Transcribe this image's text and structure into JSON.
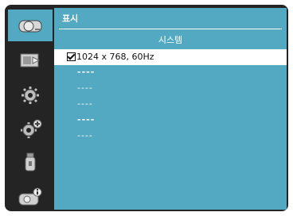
{
  "header": {
    "title": "표시"
  },
  "section": {
    "title": "시스템"
  },
  "rows": [
    {
      "label": "1024 x 768, 60Hz",
      "checked": true
    },
    {
      "label": "----"
    },
    {
      "label": "----"
    },
    {
      "label": "----"
    },
    {
      "label": "----"
    },
    {
      "label": "----"
    }
  ],
  "sidebar": {
    "tabs": [
      {
        "icon": "display-icon",
        "active": true
      },
      {
        "icon": "input-icon"
      },
      {
        "icon": "settings-gear-icon"
      },
      {
        "icon": "advanced-settings-icon"
      },
      {
        "icon": "usb-icon"
      },
      {
        "icon": "info-icon"
      }
    ]
  },
  "colors": {
    "panel": "#53a9c1",
    "frame": "#242424",
    "selected_row": "#ffffff"
  }
}
